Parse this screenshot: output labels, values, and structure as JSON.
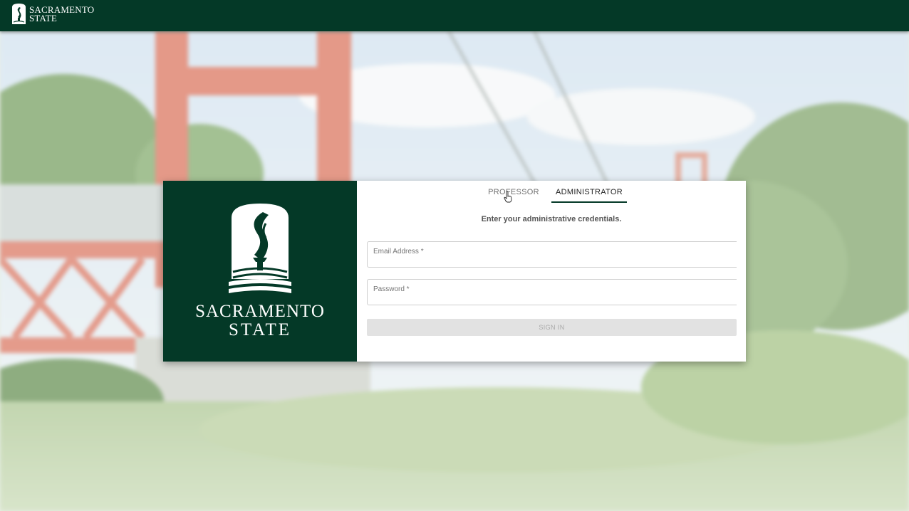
{
  "header": {
    "logo_line1": "SACRAMENTO",
    "logo_line2": "STATE",
    "logo_icon": "sac-state-torch-icon",
    "background_color": "#043927"
  },
  "brand_panel": {
    "name_line1": "SACRAMENTO",
    "name_line2": "STATE",
    "emblem_icon": "sac-state-torch-emblem-icon",
    "background_color": "#043927"
  },
  "login": {
    "tabs": [
      {
        "label": "PROFESSOR",
        "active": false
      },
      {
        "label": "ADMINISTRATOR",
        "active": true
      }
    ],
    "subtitle": "Enter your administrative credentials.",
    "email": {
      "label": "Email Address *",
      "value": ""
    },
    "password": {
      "label": "Password *",
      "value": ""
    },
    "submit_label": "SIGN IN",
    "submit_enabled": false
  },
  "pointer": {
    "icon": "hand-pointer-cursor-icon"
  }
}
